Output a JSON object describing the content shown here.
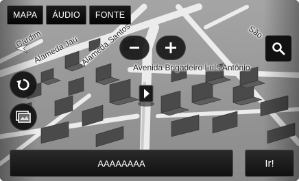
{
  "tabs": [
    {
      "label": "MAPA"
    },
    {
      "label": "ÁUDIO"
    },
    {
      "label": "FONTE"
    }
  ],
  "map": {
    "streets": [
      {
        "name": "Cardim"
      },
      {
        "name": "Alameda Jaú"
      },
      {
        "name": "Alameda Santos"
      },
      {
        "name": "Avenida Brigadeiro Luís Antônio"
      },
      {
        "name": "São"
      }
    ]
  },
  "controls": {
    "zoom_out_icon": "minus-icon",
    "zoom_in_icon": "plus-icon",
    "search_icon": "search-icon",
    "reroute_icon": "rotate-icon",
    "view_icon": "map-view-icon"
  },
  "destination": {
    "label": "AAAAAAAA"
  },
  "go_button": {
    "label": "Ir!"
  },
  "colors": {
    "road": "#e9e9e9",
    "building": "#444444",
    "ground": "#8f8f8f",
    "button_dark": "#111111"
  }
}
